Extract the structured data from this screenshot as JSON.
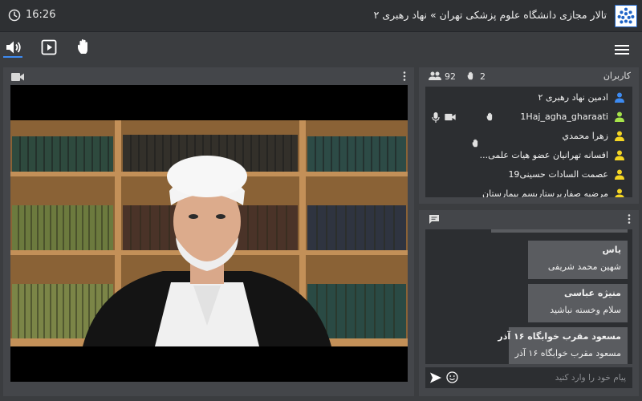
{
  "header": {
    "time": "16:26",
    "title": "تالار مجازی دانشگاه علوم پزشکی تهران » نهاد رهبری ۲"
  },
  "users": {
    "label": "کاربران",
    "total_count": "92",
    "raised_hands": "2",
    "list": [
      {
        "name": "ادمین نهاد رهبری ۲",
        "icon_color": "#3d8bf2"
      },
      {
        "name": "1Haj_agha_gharaati",
        "icon_color": "#a6e34a"
      },
      {
        "name": "زهرا محمدي",
        "icon_color": "#f5d623"
      },
      {
        "name": "افسانه تهرانیان عضو هیات علمی...",
        "icon_color": "#f5d623"
      },
      {
        "name": "عصمت السادات حسینی19",
        "icon_color": "#f5d623"
      },
      {
        "name": "مرضیه صفاریرستاربسم بیمارستان",
        "icon_color": "#f5d623"
      }
    ]
  },
  "chat": {
    "messages": [
      {
        "author": "یاس",
        "text": "شهین محمد شریفی"
      },
      {
        "author": "منیژه عباسی",
        "text": "سلام وخسته نباشید"
      },
      {
        "author": "مسعود مقرب خوابگاه ۱۶ آذر",
        "text": "مسعود مقرب خوابگاه ۱۶ آذر"
      }
    ],
    "input_placeholder": "پیام خود را وارد کنید"
  },
  "colors": {
    "accent": "#3d8bf2",
    "panel_bg": "#44464a",
    "dark_bg": "#2c2e31"
  }
}
